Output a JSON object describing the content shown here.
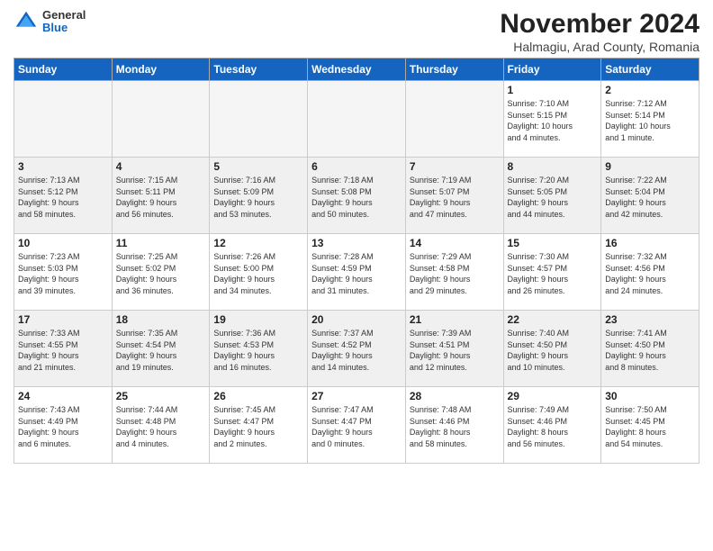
{
  "header": {
    "logo_general": "General",
    "logo_blue": "Blue",
    "month_title": "November 2024",
    "location": "Halmagiu, Arad County, Romania"
  },
  "weekdays": [
    "Sunday",
    "Monday",
    "Tuesday",
    "Wednesday",
    "Thursday",
    "Friday",
    "Saturday"
  ],
  "weeks": [
    {
      "shade": false,
      "days": [
        {
          "num": "",
          "info": ""
        },
        {
          "num": "",
          "info": ""
        },
        {
          "num": "",
          "info": ""
        },
        {
          "num": "",
          "info": ""
        },
        {
          "num": "",
          "info": ""
        },
        {
          "num": "1",
          "info": "Sunrise: 7:10 AM\nSunset: 5:15 PM\nDaylight: 10 hours\nand 4 minutes."
        },
        {
          "num": "2",
          "info": "Sunrise: 7:12 AM\nSunset: 5:14 PM\nDaylight: 10 hours\nand 1 minute."
        }
      ]
    },
    {
      "shade": true,
      "days": [
        {
          "num": "3",
          "info": "Sunrise: 7:13 AM\nSunset: 5:12 PM\nDaylight: 9 hours\nand 58 minutes."
        },
        {
          "num": "4",
          "info": "Sunrise: 7:15 AM\nSunset: 5:11 PM\nDaylight: 9 hours\nand 56 minutes."
        },
        {
          "num": "5",
          "info": "Sunrise: 7:16 AM\nSunset: 5:09 PM\nDaylight: 9 hours\nand 53 minutes."
        },
        {
          "num": "6",
          "info": "Sunrise: 7:18 AM\nSunset: 5:08 PM\nDaylight: 9 hours\nand 50 minutes."
        },
        {
          "num": "7",
          "info": "Sunrise: 7:19 AM\nSunset: 5:07 PM\nDaylight: 9 hours\nand 47 minutes."
        },
        {
          "num": "8",
          "info": "Sunrise: 7:20 AM\nSunset: 5:05 PM\nDaylight: 9 hours\nand 44 minutes."
        },
        {
          "num": "9",
          "info": "Sunrise: 7:22 AM\nSunset: 5:04 PM\nDaylight: 9 hours\nand 42 minutes."
        }
      ]
    },
    {
      "shade": false,
      "days": [
        {
          "num": "10",
          "info": "Sunrise: 7:23 AM\nSunset: 5:03 PM\nDaylight: 9 hours\nand 39 minutes."
        },
        {
          "num": "11",
          "info": "Sunrise: 7:25 AM\nSunset: 5:02 PM\nDaylight: 9 hours\nand 36 minutes."
        },
        {
          "num": "12",
          "info": "Sunrise: 7:26 AM\nSunset: 5:00 PM\nDaylight: 9 hours\nand 34 minutes."
        },
        {
          "num": "13",
          "info": "Sunrise: 7:28 AM\nSunset: 4:59 PM\nDaylight: 9 hours\nand 31 minutes."
        },
        {
          "num": "14",
          "info": "Sunrise: 7:29 AM\nSunset: 4:58 PM\nDaylight: 9 hours\nand 29 minutes."
        },
        {
          "num": "15",
          "info": "Sunrise: 7:30 AM\nSunset: 4:57 PM\nDaylight: 9 hours\nand 26 minutes."
        },
        {
          "num": "16",
          "info": "Sunrise: 7:32 AM\nSunset: 4:56 PM\nDaylight: 9 hours\nand 24 minutes."
        }
      ]
    },
    {
      "shade": true,
      "days": [
        {
          "num": "17",
          "info": "Sunrise: 7:33 AM\nSunset: 4:55 PM\nDaylight: 9 hours\nand 21 minutes."
        },
        {
          "num": "18",
          "info": "Sunrise: 7:35 AM\nSunset: 4:54 PM\nDaylight: 9 hours\nand 19 minutes."
        },
        {
          "num": "19",
          "info": "Sunrise: 7:36 AM\nSunset: 4:53 PM\nDaylight: 9 hours\nand 16 minutes."
        },
        {
          "num": "20",
          "info": "Sunrise: 7:37 AM\nSunset: 4:52 PM\nDaylight: 9 hours\nand 14 minutes."
        },
        {
          "num": "21",
          "info": "Sunrise: 7:39 AM\nSunset: 4:51 PM\nDaylight: 9 hours\nand 12 minutes."
        },
        {
          "num": "22",
          "info": "Sunrise: 7:40 AM\nSunset: 4:50 PM\nDaylight: 9 hours\nand 10 minutes."
        },
        {
          "num": "23",
          "info": "Sunrise: 7:41 AM\nSunset: 4:50 PM\nDaylight: 9 hours\nand 8 minutes."
        }
      ]
    },
    {
      "shade": false,
      "days": [
        {
          "num": "24",
          "info": "Sunrise: 7:43 AM\nSunset: 4:49 PM\nDaylight: 9 hours\nand 6 minutes."
        },
        {
          "num": "25",
          "info": "Sunrise: 7:44 AM\nSunset: 4:48 PM\nDaylight: 9 hours\nand 4 minutes."
        },
        {
          "num": "26",
          "info": "Sunrise: 7:45 AM\nSunset: 4:47 PM\nDaylight: 9 hours\nand 2 minutes."
        },
        {
          "num": "27",
          "info": "Sunrise: 7:47 AM\nSunset: 4:47 PM\nDaylight: 9 hours\nand 0 minutes."
        },
        {
          "num": "28",
          "info": "Sunrise: 7:48 AM\nSunset: 4:46 PM\nDaylight: 8 hours\nand 58 minutes."
        },
        {
          "num": "29",
          "info": "Sunrise: 7:49 AM\nSunset: 4:46 PM\nDaylight: 8 hours\nand 56 minutes."
        },
        {
          "num": "30",
          "info": "Sunrise: 7:50 AM\nSunset: 4:45 PM\nDaylight: 8 hours\nand 54 minutes."
        }
      ]
    }
  ]
}
